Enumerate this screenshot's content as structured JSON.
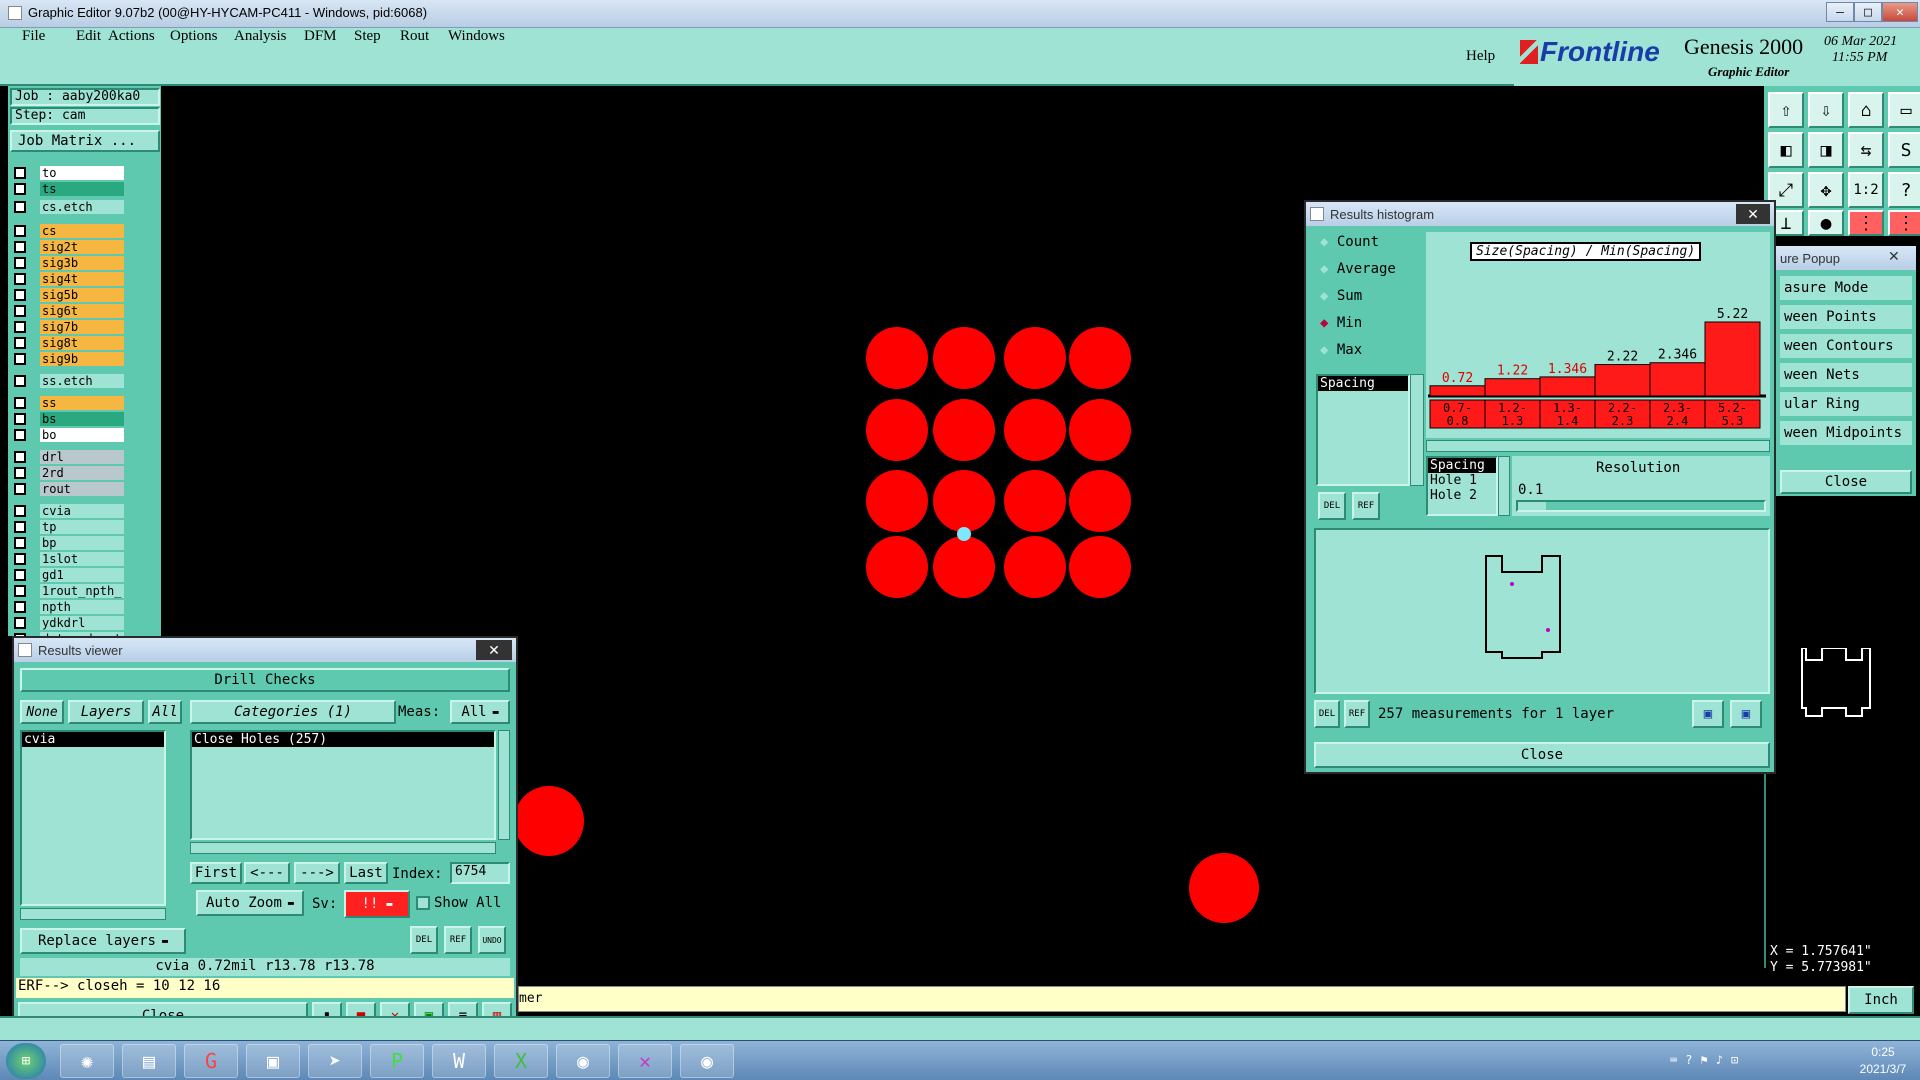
{
  "window": {
    "title": "Graphic Editor 9.07b2 (00@HY-HYCAM-PC411 - Windows, pid:6068)"
  },
  "menubar": {
    "items": [
      "File",
      "Edit",
      "Actions",
      "Options",
      "Analysis",
      "DFM",
      "Step",
      "Rout",
      "Windows"
    ],
    "help": "Help"
  },
  "brand": {
    "logo": "Frontline",
    "product": "Genesis 2000",
    "subtitle": "Graphic Editor",
    "date": "06 Mar 2021",
    "time": "11:55 PM"
  },
  "job": {
    "job_label": "Job : aaby200ka0",
    "step_label": "Step: cam",
    "matrix_button": "Job Matrix ..."
  },
  "layers": [
    {
      "name": "to",
      "color": "#ffffff"
    },
    {
      "name": "ts",
      "color": "#2aa880"
    },
    {
      "name": "cs.etch",
      "color": "#9ee3d3"
    },
    {
      "name": "cs",
      "color": "#f5b642"
    },
    {
      "name": "sig2t",
      "color": "#f5b642"
    },
    {
      "name": "sig3b",
      "color": "#f5b642"
    },
    {
      "name": "sig4t",
      "color": "#f5b642"
    },
    {
      "name": "sig5b",
      "color": "#f5b642"
    },
    {
      "name": "sig6t",
      "color": "#f5b642"
    },
    {
      "name": "sig7b",
      "color": "#f5b642"
    },
    {
      "name": "sig8t",
      "color": "#f5b642"
    },
    {
      "name": "sig9b",
      "color": "#f5b642"
    },
    {
      "name": "ss.etch",
      "color": "#9ee3d3"
    },
    {
      "name": "ss",
      "color": "#f5b642"
    },
    {
      "name": "bs",
      "color": "#2aa880"
    },
    {
      "name": "bo",
      "color": "#ffffff"
    },
    {
      "name": "drl",
      "color": "#b8c8cc"
    },
    {
      "name": "2rd",
      "color": "#b8c8cc"
    },
    {
      "name": "rout",
      "color": "#b8c8cc"
    },
    {
      "name": "cvia",
      "color": "#9ee3d3"
    },
    {
      "name": "tp",
      "color": "#9ee3d3"
    },
    {
      "name": "bp",
      "color": "#9ee3d3"
    },
    {
      "name": "1slot",
      "color": "#9ee3d3"
    },
    {
      "name": "gd1",
      "color": "#9ee3d3"
    },
    {
      "name": "1rout_npth_",
      "color": "#9ee3d3"
    },
    {
      "name": "npth",
      "color": "#9ee3d3"
    },
    {
      "name": "ydkdrl",
      "color": "#9ee3d3"
    },
    {
      "name": "datecode-pt",
      "color": "#9ee3d3"
    }
  ],
  "histogram": {
    "window_title": "Results histogram",
    "radios": [
      "Count",
      "Average",
      "Sum",
      "Min",
      "Max"
    ],
    "selected_radio": "Min",
    "list_item": "Spacing",
    "chart_title": "Size(Spacing) / Min(Spacing)",
    "resolution_label": "Resolution",
    "resolution_value": "0.1",
    "attr_items": [
      "Spacing",
      "Hole 1",
      "Hole 2"
    ],
    "status": "257 measurements for 1 layer",
    "close": "Close",
    "del": "DEL",
    "ref": "REF"
  },
  "chart_data": {
    "type": "bar",
    "title": "Size(Spacing) / Min(Spacing)",
    "categories": [
      "0.7-0.8",
      "1.2-1.3",
      "1.3-1.4",
      "2.2-2.3",
      "2.3-2.4",
      "5.2-5.3"
    ],
    "values": [
      0.72,
      1.22,
      1.346,
      2.22,
      2.346,
      5.22
    ],
    "value_labels": [
      "0.72",
      "1.22",
      "1.346",
      "2.22",
      "2.346",
      "5.22"
    ],
    "colors": [
      "#ff1a1a"
    ]
  },
  "measure_popup": {
    "title": "ure Popup",
    "items": [
      "asure Mode",
      "ween Points",
      "ween Contours",
      "ween Nets",
      "ular Ring",
      "ween Midpoints"
    ],
    "close": "Close"
  },
  "viewer": {
    "window_title": "Results viewer",
    "header": "Drill Checks",
    "none": "None",
    "layers": "Layers",
    "all": "All",
    "categories": "Categories (1)",
    "meas_label": "Meas:",
    "meas_value": "All",
    "layer_item": "cvia",
    "category_item": "Close Holes (257)",
    "first": "First",
    "prev": "<---",
    "next": "--->",
    "last": "Last",
    "index_label": "Index:",
    "index_value": "6754",
    "auto_zoom": "Auto Zoom",
    "sv_label": "Sv:",
    "sv_value": "!!",
    "show_all": "Show All",
    "replace_layers": "Replace layers",
    "info_line": "cvia 0.72mil  r13.78  r13.78",
    "erf_line": "ERF--> closeh = 10 12 16",
    "close": "Close",
    "del": "DEL",
    "ref": "REF",
    "undo": "UNDO"
  },
  "coords": {
    "x": "X = 1.757641\"",
    "y": "Y = 5.773981\""
  },
  "command": {
    "text": "mer",
    "units": "Inch"
  },
  "taskbar": {
    "time": "0:25",
    "date": "2021/3/7"
  }
}
